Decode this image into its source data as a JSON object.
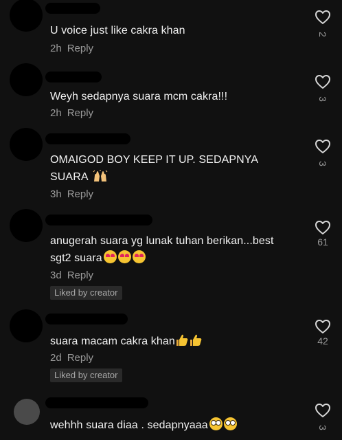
{
  "comments": [
    {
      "text": "U voice just like cakra khan",
      "time": "2h",
      "reply": "Reply",
      "likes": "2",
      "liked_by_creator": ""
    },
    {
      "text": "Weyh sedapnya suara mcm cakra!!!",
      "time": "2h",
      "reply": "Reply",
      "likes": "3",
      "liked_by_creator": ""
    },
    {
      "text_line1": "OMAIGOD BOY KEEP IT UP. SEDAPNYA",
      "text_line2": "SUARA",
      "time": "3h",
      "reply": "Reply",
      "likes": "3",
      "liked_by_creator": ""
    },
    {
      "text_line1": "anugerah suara yg lunak tuhan berikan...best",
      "text_line2": "sgt2 suara",
      "time": "3d",
      "reply": "Reply",
      "likes": "61",
      "liked_by_creator": "Liked by creator"
    },
    {
      "text": "suara macam cakra khan",
      "time": "2d",
      "reply": "Reply",
      "likes": "42",
      "liked_by_creator": "Liked by creator"
    },
    {
      "text": "wehhh suara diaa . sedapnyaaa",
      "time": "",
      "reply": "",
      "likes": "3",
      "liked_by_creator": ""
    }
  ],
  "icons": {
    "like": "heart-outline-icon",
    "emoji_raise_hands": "raising-hands-icon",
    "emoji_heart_eyes": "heart-eyes-emoji-icon",
    "emoji_thumbs_up": "thumbs-up-icon",
    "emoji_flushed": "flushed-emoji-icon"
  },
  "colors": {
    "background": "#111111",
    "text": "#f2f2f2",
    "secondary": "#9a9a9a",
    "badge": "#2a2a2a"
  }
}
